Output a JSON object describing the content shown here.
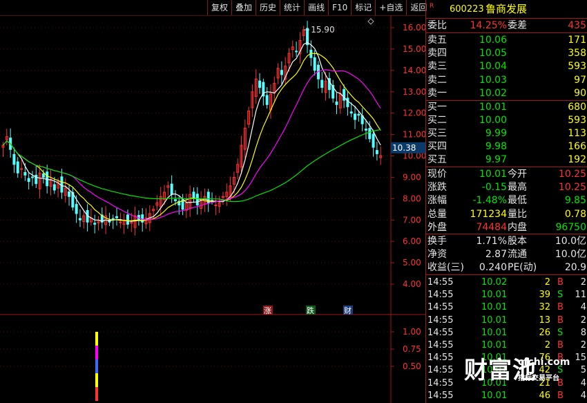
{
  "toolbar": {
    "items": [
      "复权",
      "叠加",
      "历史",
      "统计",
      "画线",
      "F10",
      "标记",
      "+自选",
      "返回"
    ]
  },
  "stock": {
    "badge": "R",
    "code": "600223",
    "name": "鲁商发展"
  },
  "ratio": {
    "label1": "委比",
    "value1": "14.25%",
    "label2": "委差",
    "value2": "435"
  },
  "asks": [
    {
      "label": "卖五",
      "price": "10.06",
      "volume": "171"
    },
    {
      "label": "卖四",
      "price": "10.05",
      "volume": "358"
    },
    {
      "label": "卖三",
      "price": "10.04",
      "volume": "593"
    },
    {
      "label": "卖二",
      "price": "10.03",
      "volume": "97"
    },
    {
      "label": "卖一",
      "price": "10.02",
      "volume": "90"
    }
  ],
  "bids": [
    {
      "label": "买一",
      "price": "10.01",
      "volume": "680"
    },
    {
      "label": "买二",
      "price": "10.00",
      "volume": "593"
    },
    {
      "label": "买三",
      "price": "9.99",
      "volume": "113"
    },
    {
      "label": "买四",
      "price": "9.98",
      "volume": "166"
    },
    {
      "label": "买五",
      "price": "9.97",
      "volume": "192"
    }
  ],
  "quote": [
    {
      "l1": "现价",
      "v1": "10.01",
      "c1": "green",
      "l2": "今开",
      "v2": "10.25",
      "c2": "red"
    },
    {
      "l1": "涨跌",
      "v1": "-0.15",
      "c1": "green",
      "l2": "最高",
      "v2": "10.25",
      "c2": "red"
    },
    {
      "l1": "涨幅",
      "v1": "-1.48%",
      "c1": "green",
      "l2": "最低",
      "v2": "9.85",
      "c2": "green"
    },
    {
      "l1": "总量",
      "v1": "171234",
      "c1": "yellow",
      "l2": "量比",
      "v2": "0.78",
      "c2": "yellow"
    },
    {
      "l1": "外盘",
      "v1": "74484",
      "c1": "red",
      "l2": "内盘",
      "v2": "96750",
      "c2": "green"
    }
  ],
  "finance": [
    {
      "l1": "换手",
      "v1": "1.71%",
      "l2": "股本",
      "v2": "10.0亿"
    },
    {
      "l1": "净资",
      "v1": "2.87",
      "l2": "流通",
      "v2": "10.0亿"
    },
    {
      "l1": "收益(三)",
      "v1": "0.240",
      "l2": "PE(动)",
      "v2": "20.9"
    }
  ],
  "ticks": [
    {
      "time": "14:55",
      "price": "10.02",
      "vol": "2",
      "side": "B",
      "num": "2"
    },
    {
      "time": "14:55",
      "price": "10.01",
      "vol": "39",
      "side": "S",
      "num": "11"
    },
    {
      "time": "14:55",
      "price": "10.01",
      "vol": "32",
      "side": "B",
      "num": "4"
    },
    {
      "time": "14:55",
      "price": "10.01",
      "vol": "13",
      "side": "B",
      "num": "2"
    },
    {
      "time": "14:55",
      "price": "10.01",
      "vol": "26",
      "side": "S",
      "num": "8"
    },
    {
      "time": "14:55",
      "price": "10.01",
      "vol": "2",
      "side": "B",
      "num": "2"
    },
    {
      "time": "14:55",
      "price": "10.01",
      "vol": "76",
      "side": "B",
      "num": "15"
    },
    {
      "time": "14:55",
      "price": "10.01",
      "vol": "42",
      "side": "S",
      "num": "5"
    },
    {
      "time": "14:55",
      "price": "10.01",
      "vol": "21",
      "side": "B",
      "num": "4"
    },
    {
      "time": "14:55",
      "price": "10.01",
      "vol": "46",
      "side": "B",
      "num": "4"
    }
  ],
  "markers": {
    "rise": "涨",
    "fall": "跌",
    "finance": "财"
  },
  "watermark": {
    "main": "财富池",
    "url": "cfchi.com",
    "sub": "指标交易平台"
  },
  "chart_data": {
    "type": "candlestick",
    "y_ticks": [
      "16.00",
      "15.00",
      "14.00",
      "13.00",
      "12.00",
      "11.00",
      "10.00",
      "9.00",
      "8.00",
      "7.00",
      "6.00",
      "5.00",
      "4.00"
    ],
    "ylim": [
      3.5,
      16.5
    ],
    "peak_label": "15.90",
    "current_price": "10.38",
    "close": [
      10.5,
      10.9,
      10.3,
      9.6,
      9.2,
      9.4,
      9.1,
      8.8,
      9.0,
      8.7,
      9.2,
      9.0,
      8.6,
      8.9,
      8.4,
      8.8,
      8.3,
      8.5,
      8.1,
      7.6,
      7.3,
      7.0,
      7.2,
      6.9,
      7.1,
      6.8,
      7.0,
      6.9,
      7.2,
      6.9,
      7.0,
      7.1,
      6.9,
      7.0,
      6.8,
      6.9,
      7.2,
      7.0,
      6.9,
      7.1,
      7.3,
      7.5,
      7.8,
      8.1,
      8.3,
      8.6,
      8.2,
      7.9,
      7.7,
      7.5,
      7.8,
      8.2,
      8.0,
      7.7,
      7.9,
      8.1,
      7.8,
      7.9,
      7.7,
      7.8,
      8.1,
      8.3,
      8.6,
      9.0,
      9.6,
      10.5,
      11.3,
      12.1,
      13.0,
      13.6,
      13.2,
      12.8,
      12.4,
      12.9,
      13.4,
      14.1,
      13.8,
      14.2,
      14.8,
      15.1,
      14.9,
      15.4,
      15.9,
      15.2,
      14.6,
      14.0,
      13.6,
      13.2,
      13.5,
      13.1,
      12.7,
      12.4,
      12.9,
      12.6,
      12.3,
      12.0,
      11.7,
      11.9,
      11.5,
      11.2,
      10.8,
      10.4,
      10.1,
      10.01
    ],
    "volume_peak": 1.0,
    "volume_ticks": [
      "1.00",
      "0.75",
      "0.50"
    ],
    "volume_ylim": [
      0,
      1.2
    ]
  },
  "colors": {
    "up": "#ff3232",
    "down": "#54ffff",
    "ma5": "#ffffff",
    "ma10": "#ffff00",
    "ma20": "#ff00ff",
    "ma60": "#00e600",
    "frame": "#a01818"
  }
}
